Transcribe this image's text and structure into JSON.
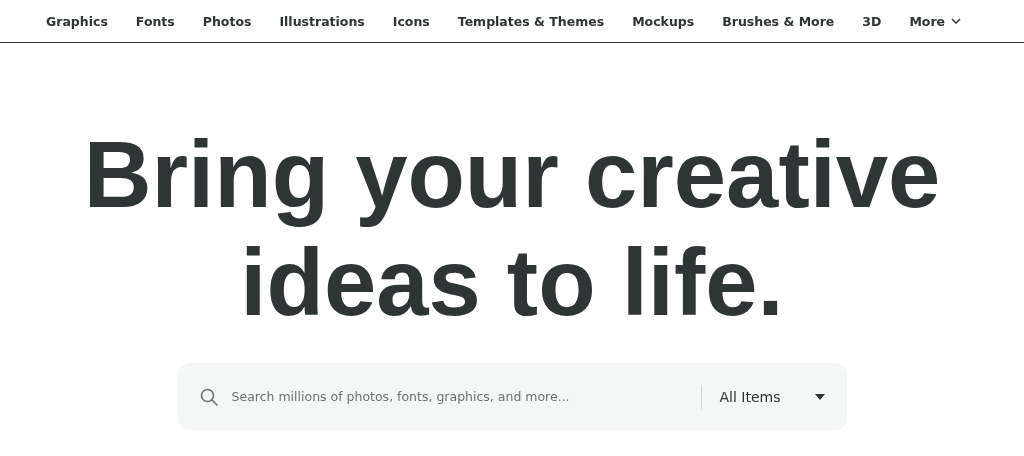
{
  "nav": {
    "items": [
      {
        "label": "Graphics"
      },
      {
        "label": "Fonts"
      },
      {
        "label": "Photos"
      },
      {
        "label": "Illustrations"
      },
      {
        "label": "Icons"
      },
      {
        "label": "Templates & Themes"
      },
      {
        "label": "Mockups"
      },
      {
        "label": "Brushes & More"
      },
      {
        "label": "3D"
      },
      {
        "label": "More",
        "kind": "dropdown"
      }
    ]
  },
  "headline": "Bring your creative ideas to life.",
  "search": {
    "placeholder": "Search millions of photos, fonts, graphics, and more...",
    "category": "All Items"
  }
}
